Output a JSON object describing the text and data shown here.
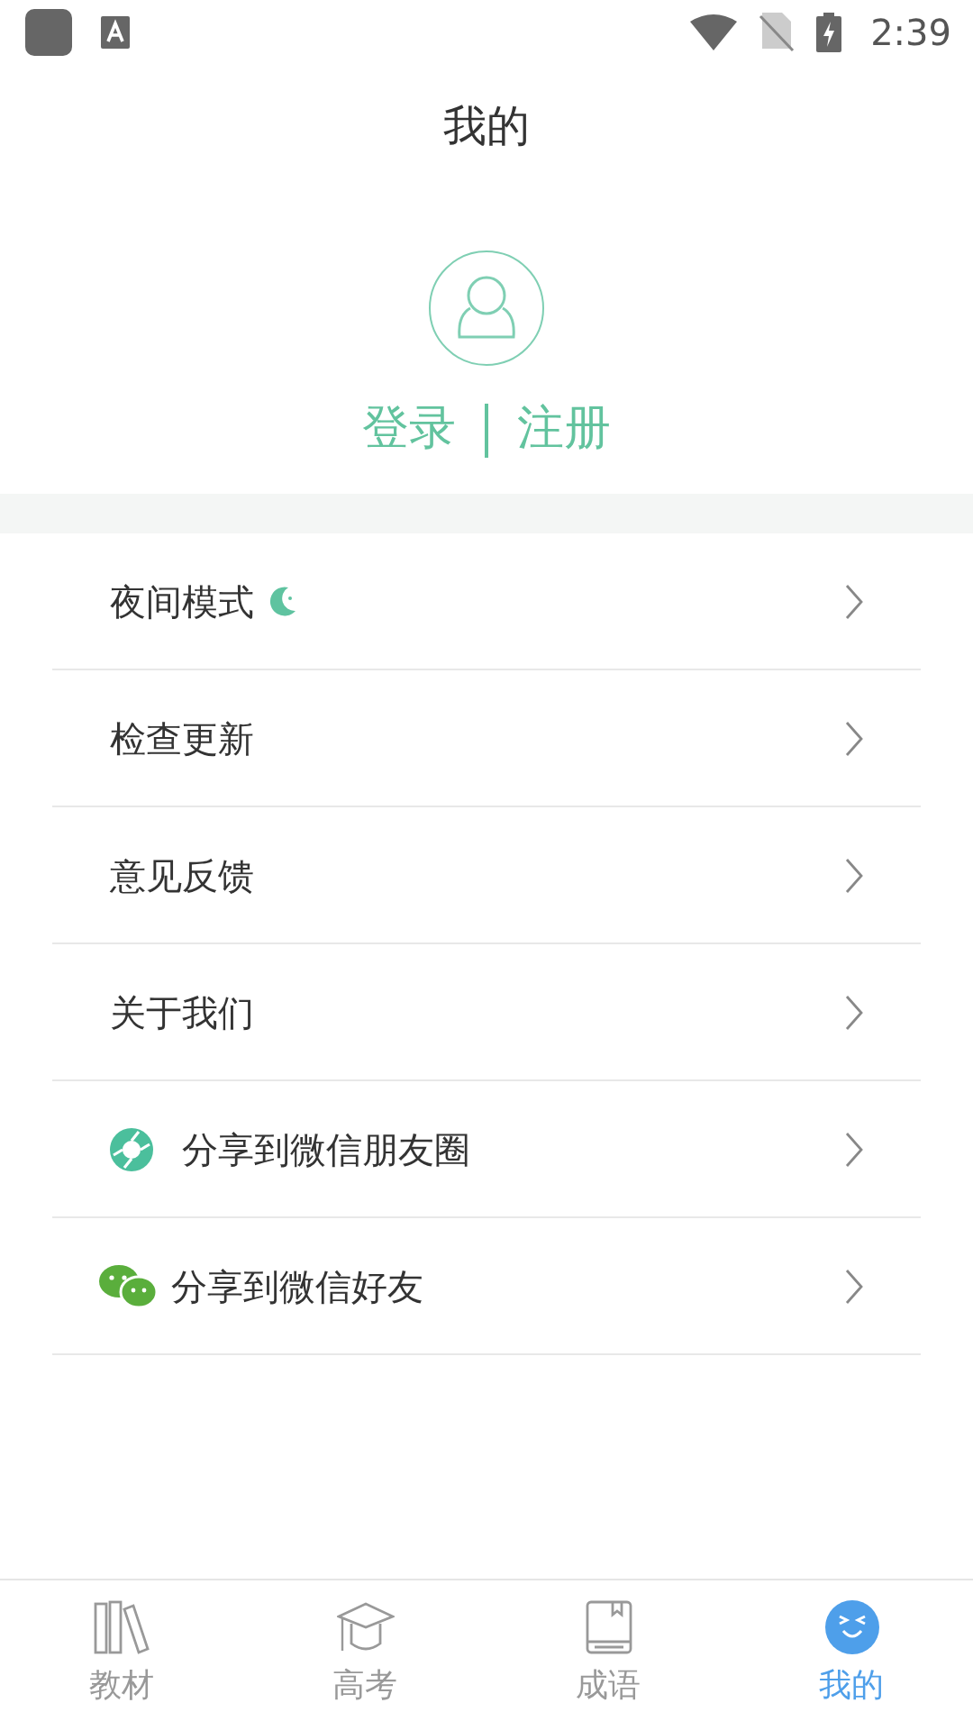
{
  "status_bar": {
    "time": "2:39"
  },
  "title": "我的",
  "account": {
    "login": "登录",
    "register": "注册"
  },
  "menu": [
    {
      "label": "夜间模式",
      "kind": "night"
    },
    {
      "label": "检查更新",
      "kind": "plain"
    },
    {
      "label": "意见反馈",
      "kind": "plain"
    },
    {
      "label": "关于我们",
      "kind": "plain"
    },
    {
      "label": "分享到微信朋友圈",
      "kind": "moments"
    },
    {
      "label": "分享到微信好友",
      "kind": "wechat"
    }
  ],
  "tabs": [
    {
      "label": "教材",
      "kind": "books",
      "selected": false
    },
    {
      "label": "高考",
      "kind": "cap",
      "selected": false
    },
    {
      "label": "成语",
      "kind": "book",
      "selected": false
    },
    {
      "label": "我的",
      "kind": "face",
      "selected": true
    }
  ]
}
